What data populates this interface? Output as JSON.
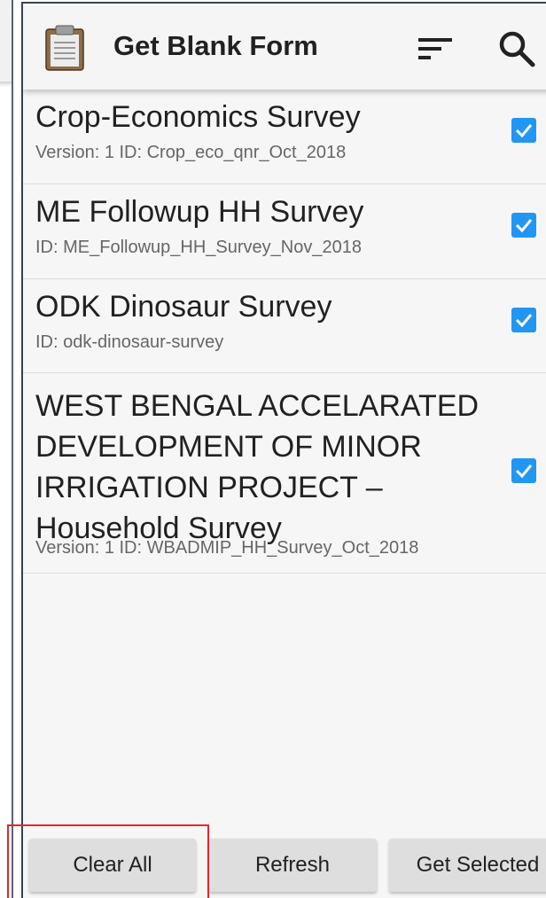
{
  "app_bar": {
    "title": "Get Blank Form",
    "app_icon": "clipboard-icon",
    "actions": [
      "sort-icon",
      "search-icon"
    ]
  },
  "forms": [
    {
      "title": "Crop-Economics Survey",
      "subtitle": "Version: 1 ID: Crop_eco_qnr_Oct_2018",
      "checked": true
    },
    {
      "title": "ME Followup HH Survey",
      "subtitle": "ID: ME_Followup_HH_Survey_Nov_2018",
      "checked": true
    },
    {
      "title": "ODK Dinosaur Survey",
      "subtitle": "ID: odk-dinosaur-survey",
      "checked": true
    },
    {
      "title": "WEST BENGAL ACCELARATED DEVELOPMENT OF MINOR IRRIGATION PROJECT –Household Survey",
      "subtitle": "Version: 1 ID: WBADMIP_HH_Survey_Oct_2018",
      "checked": true
    }
  ],
  "buttons": {
    "clear_all": "Clear All",
    "refresh": "Refresh",
    "get_selected": "Get Selected"
  },
  "colors": {
    "checkbox": "#2196f3",
    "highlight": "#e0282e",
    "app_bar": "#f5f5f5",
    "button": "#dedede"
  }
}
